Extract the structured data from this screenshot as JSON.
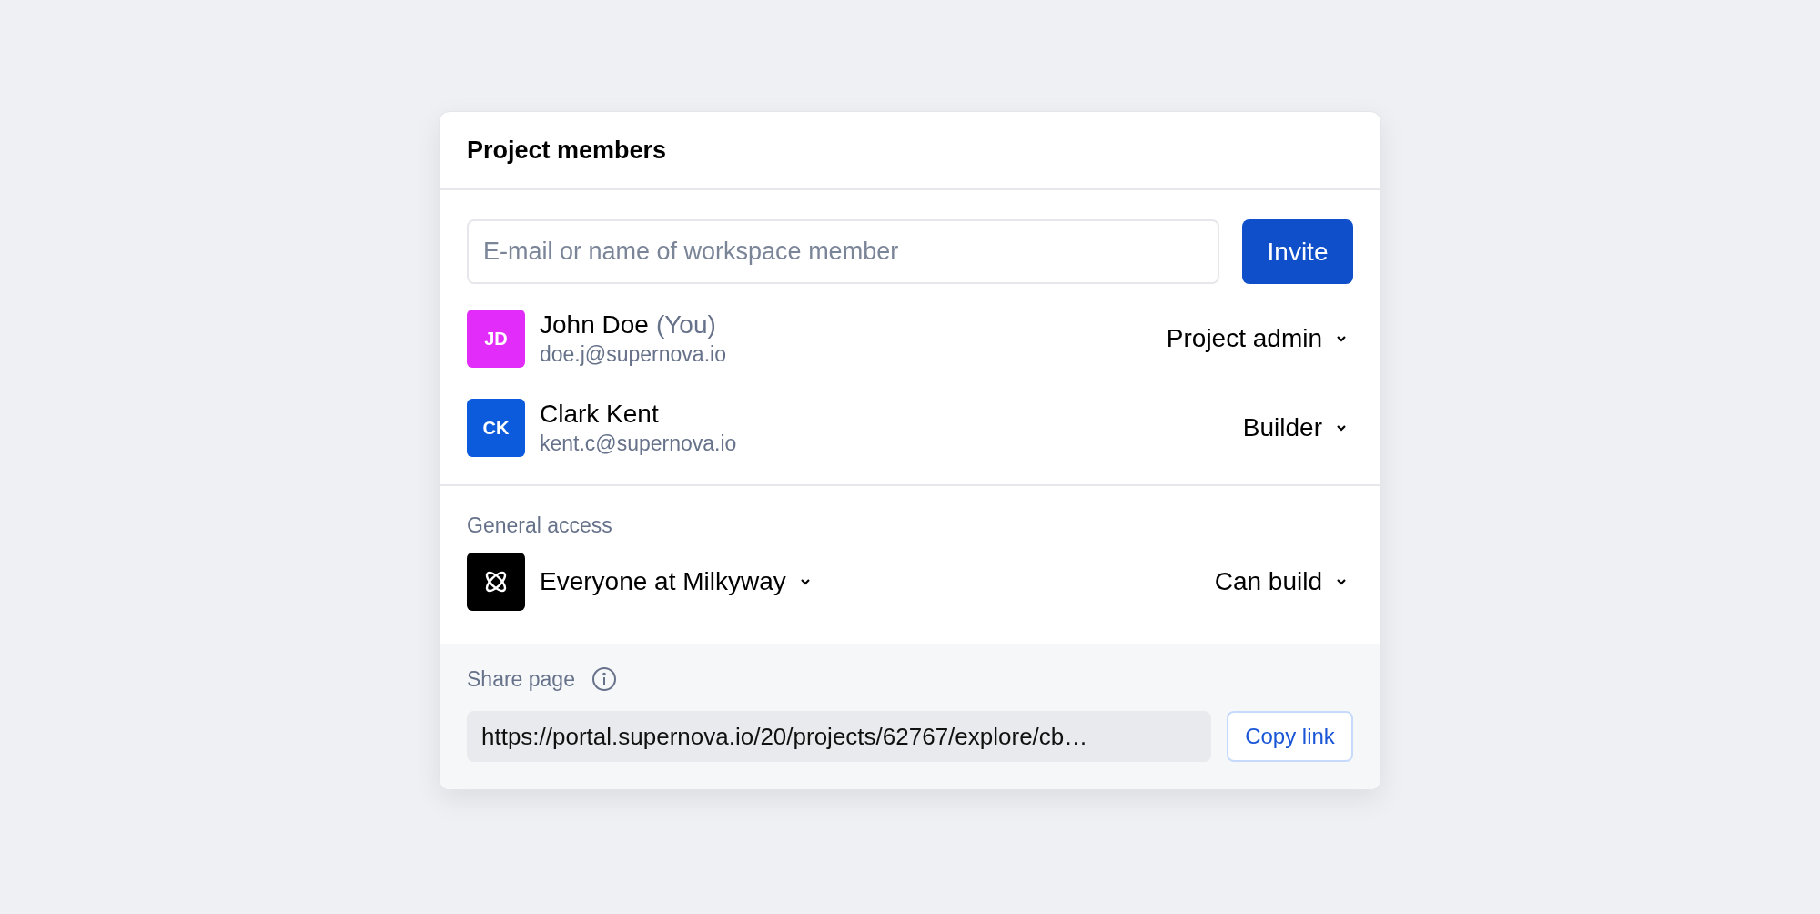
{
  "dialog": {
    "title": "Project members"
  },
  "invite": {
    "placeholder": "E-mail or name of workspace member",
    "button": "Invite"
  },
  "members": [
    {
      "initials": "JD",
      "color": "#e22cf9",
      "name": "John Doe",
      "tag": "(You)",
      "email": "doe.j@supernova.io",
      "role": "Project admin"
    },
    {
      "initials": "CK",
      "color": "#0b5bdc",
      "name": "Clark Kent",
      "email": "kent.c@supernova.io",
      "role": "Builder"
    }
  ],
  "general_access": {
    "label": "General access",
    "scope": "Everyone at Milkyway",
    "permission": "Can build"
  },
  "share": {
    "label": "Share page",
    "url": "https://portal.supernova.io/20/projects/62767/explore/cb…",
    "button": "Copy link"
  }
}
